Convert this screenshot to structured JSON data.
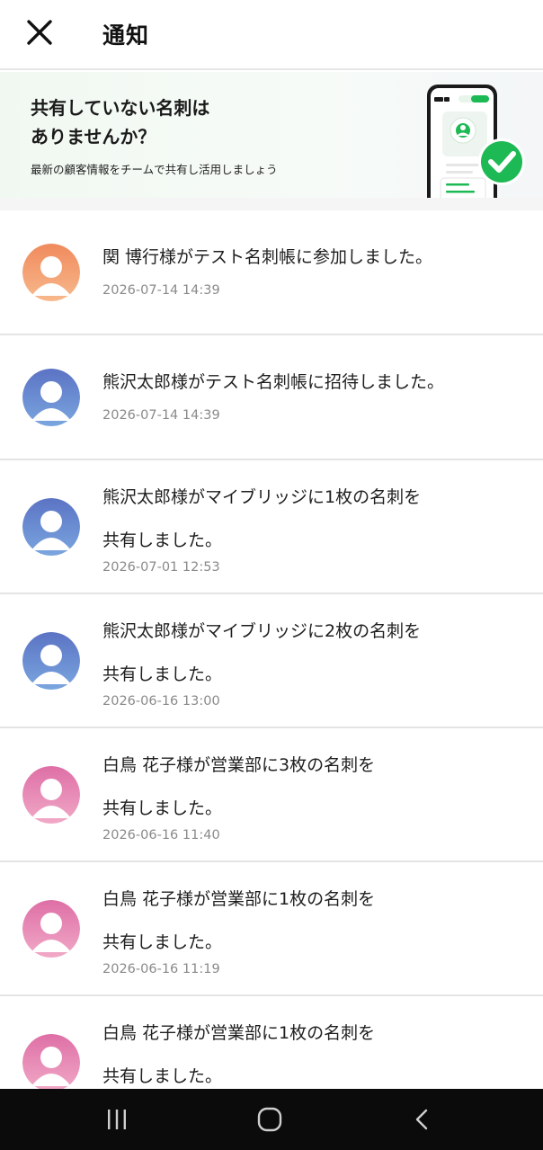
{
  "header": {
    "title": "通知",
    "close_icon": "close-icon"
  },
  "banner": {
    "title_line1": "共有していない名刺は",
    "title_line2": "ありませんか？",
    "subtitle": "最新の顧客情報をチームで共有し活用しましょう",
    "art_icon": "phone-check-icon",
    "colors": {
      "accent": "#1db954"
    }
  },
  "notifications": [
    {
      "line1": "関 博行様がテスト名刺帳に参加しました。",
      "line2": "",
      "time": "2026-07-14 14:39",
      "avatar_color": "orange"
    },
    {
      "line1": "熊沢太郎様がテスト名刺帳に招待しました。",
      "line2": "",
      "time": "2026-07-14 14:39",
      "avatar_color": "blue"
    },
    {
      "line1": "熊沢太郎様がマイブリッジに1枚の名刺を",
      "line2": "共有しました。",
      "time": "2026-07-01 12:53",
      "avatar_color": "blue"
    },
    {
      "line1": "熊沢太郎様がマイブリッジに2枚の名刺を",
      "line2": "共有しました。",
      "time": "2026-06-16 13:00",
      "avatar_color": "blue"
    },
    {
      "line1": "白鳥 花子様が営業部に3枚の名刺を",
      "line2": "共有しました。",
      "time": "2026-06-16 11:40",
      "avatar_color": "pink"
    },
    {
      "line1": "白鳥 花子様が営業部に1枚の名刺を",
      "line2": "共有しました。",
      "time": "2026-06-16 11:19",
      "avatar_color": "pink"
    },
    {
      "line1": "白鳥 花子様が営業部に1枚の名刺を",
      "line2": "共有しました。",
      "time": "",
      "avatar_color": "pink"
    }
  ],
  "navbar": {
    "recent_icon": "recent-apps-icon",
    "home_icon": "home-icon",
    "back_icon": "back-icon"
  }
}
